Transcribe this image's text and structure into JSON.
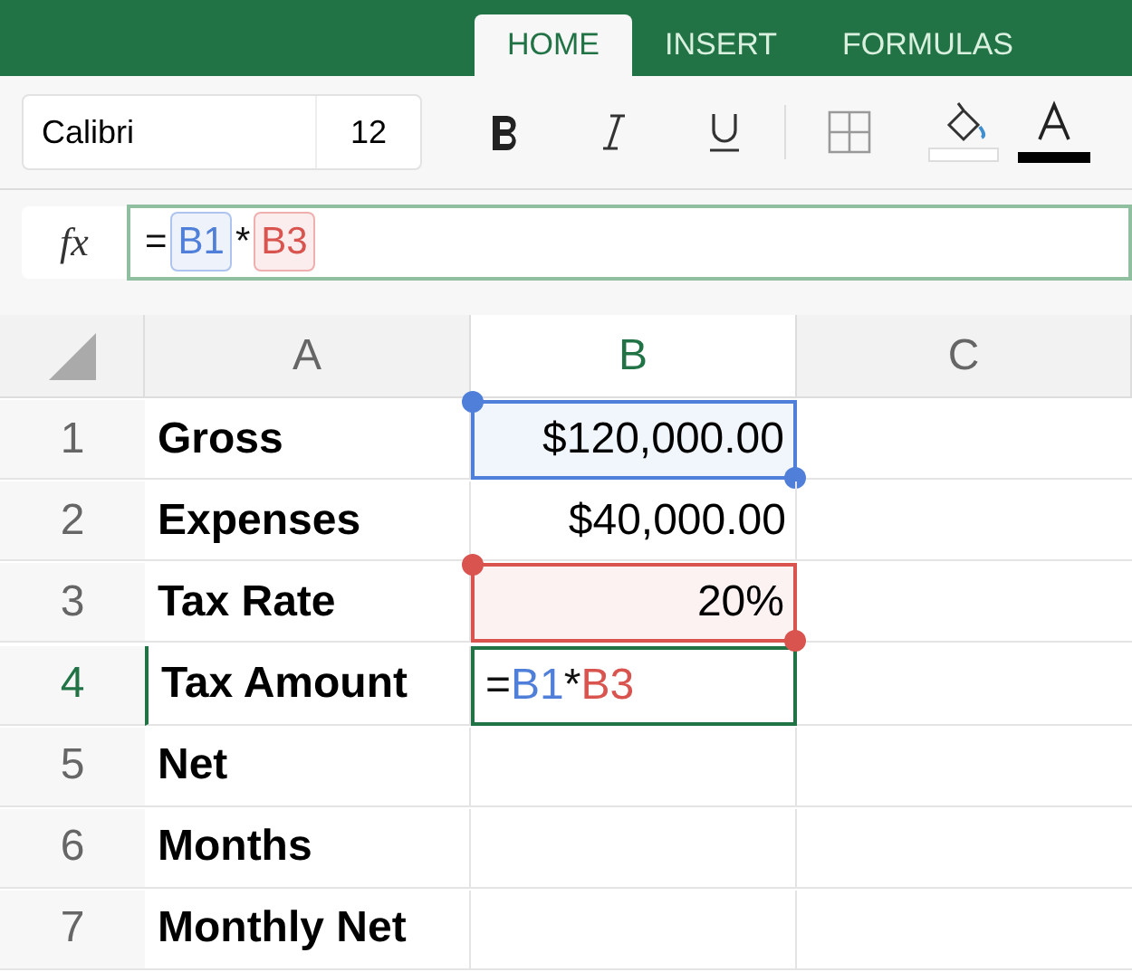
{
  "ribbon_tabs": [
    {
      "label": "HOME",
      "selected": true
    },
    {
      "label": "INSERT",
      "selected": false
    },
    {
      "label": "FORMULAS",
      "selected": false
    }
  ],
  "toolbar": {
    "font_name": "Calibri",
    "font_size": "12"
  },
  "formula_bar": {
    "label": "fx",
    "tokens": [
      {
        "kind": "text",
        "text": "="
      },
      {
        "kind": "ref",
        "text": "B1",
        "color": "#4f7fd9"
      },
      {
        "kind": "text",
        "text": "*"
      },
      {
        "kind": "ref",
        "text": "B3",
        "color": "#d9534f"
      }
    ]
  },
  "columns": [
    {
      "label": "A",
      "selected": false
    },
    {
      "label": "B",
      "selected": true
    },
    {
      "label": "C",
      "selected": false
    }
  ],
  "rows": [
    {
      "number": "1",
      "selected": false,
      "label": "Gross",
      "value": "$120,000.00",
      "color": "#4f7fd9"
    },
    {
      "number": "2",
      "selected": false,
      "label": "Expenses",
      "value": "$40,000.00"
    },
    {
      "number": "3",
      "selected": false,
      "label": "Tax Rate",
      "value": "20%",
      "color": "#d9534f"
    },
    {
      "number": "4",
      "selected": true,
      "label": "Tax Amount",
      "tokens": [
        {
          "kind": "text",
          "text": "="
        },
        {
          "kind": "ref",
          "text": "B1",
          "color": "#4f7fd9"
        },
        {
          "kind": "text",
          "text": "*"
        },
        {
          "kind": "ref",
          "text": "B3",
          "color": "#d9534f"
        }
      ]
    },
    {
      "number": "5",
      "selected": false,
      "label": "Net"
    },
    {
      "number": "6",
      "selected": false,
      "label": "Months"
    },
    {
      "number": "7",
      "selected": false,
      "label": "Monthly Net"
    }
  ]
}
